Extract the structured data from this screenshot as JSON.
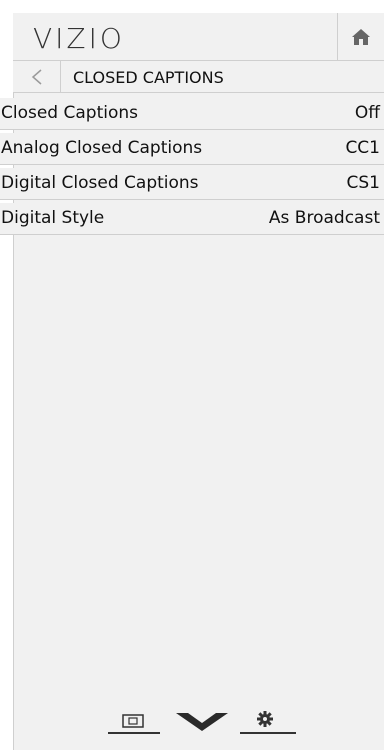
{
  "header": {
    "logo_text": "VIZIO",
    "home_icon": "home-icon"
  },
  "subheader": {
    "back_icon": "back-arrow-icon",
    "title": "CLOSED CAPTIONS"
  },
  "menu": {
    "items": [
      {
        "label": "Closed Captions",
        "value": "Off"
      },
      {
        "label": "Analog Closed Captions",
        "value": "CC1"
      },
      {
        "label": "Digital Closed Captions",
        "value": "CS1"
      },
      {
        "label": "Digital Style",
        "value": "As Broadcast"
      }
    ]
  },
  "bottom_bar": {
    "icons": [
      "input-icon",
      "chevron-down-icon",
      "gear-icon"
    ]
  },
  "colors": {
    "panel_bg": "#f1f1f1",
    "divider": "#cfcfcf",
    "text": "#111111"
  }
}
